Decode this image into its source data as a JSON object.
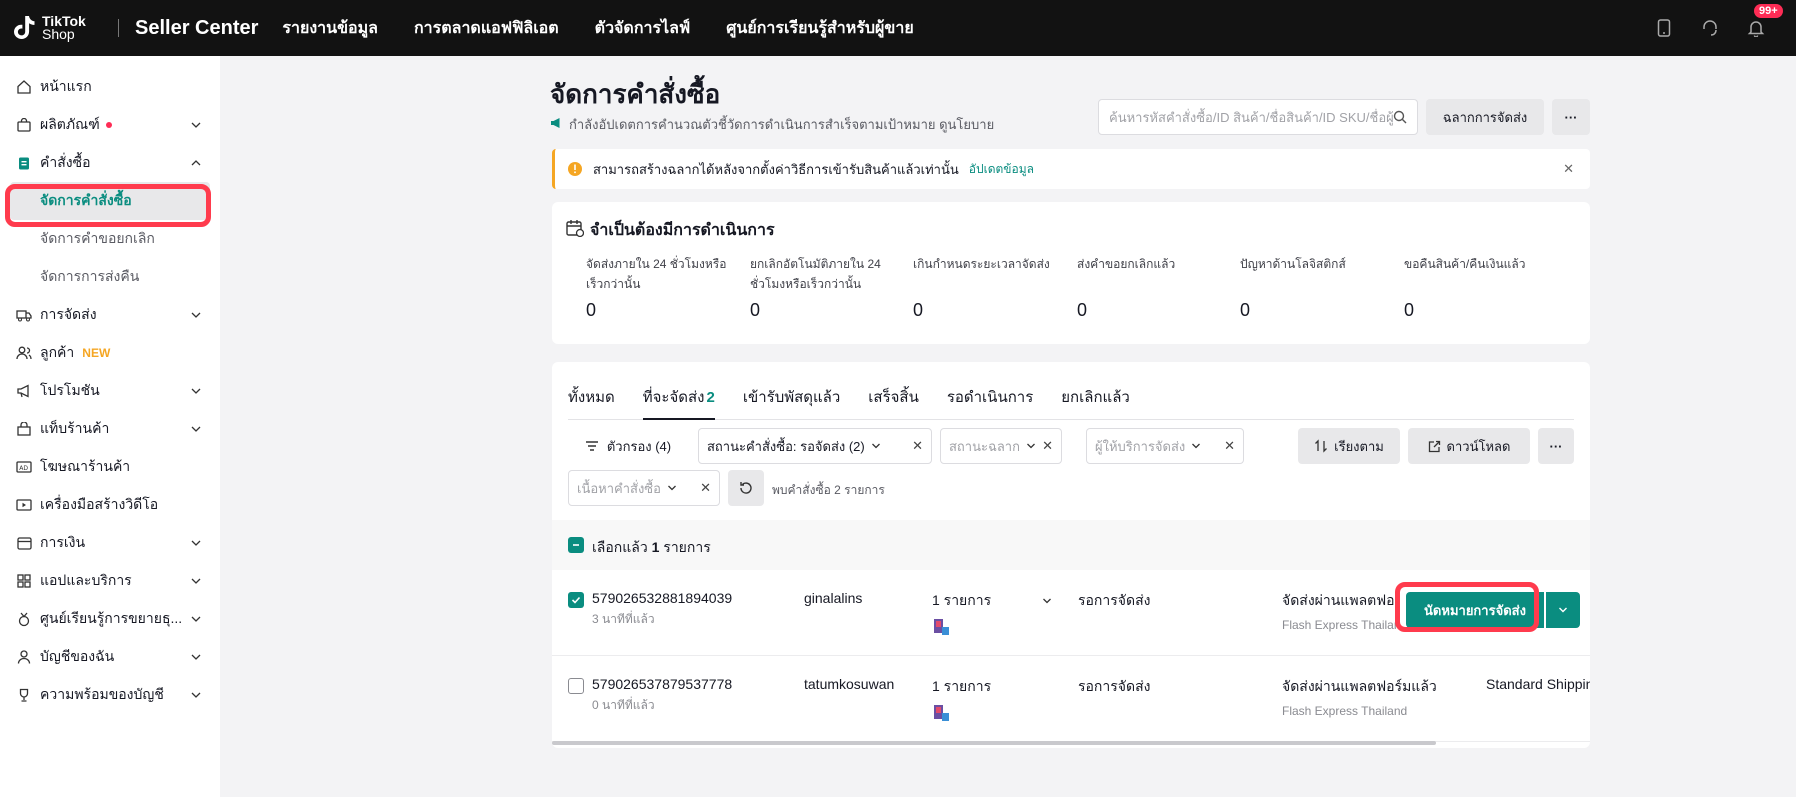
{
  "topbar": {
    "logo_text_1": "TikTok",
    "logo_text_2": "Shop",
    "app_title": "Seller Center",
    "nav": [
      "รายงานข้อมูล",
      "การตลาดแอฟฟิลิเอต",
      "ตัวจัดการไลฟ์",
      "ศูนย์การเรียนรู้สำหรับผู้ขาย"
    ],
    "notification_badge": "99+"
  },
  "sidebar": {
    "items": [
      {
        "label": "หน้าแรก",
        "icon": "home-icon"
      },
      {
        "label": "ผลิตภัณฑ์",
        "icon": "bag-icon"
      },
      {
        "label": "คำสั่งซื้อ",
        "icon": "clipboard-icon"
      },
      {
        "label": "จัดการคำสั่งซื้อ"
      },
      {
        "label": "จัดการคำขอยกเลิก"
      },
      {
        "label": "จัดการการส่งคืน"
      },
      {
        "label": "การจัดส่ง",
        "icon": "truck-icon"
      },
      {
        "label": "ลูกค้า",
        "icon": "users-icon",
        "tag": "NEW"
      },
      {
        "label": "โปรโมชัน",
        "icon": "megaphone-icon"
      },
      {
        "label": "แท็บร้านค้า",
        "icon": "store-icon"
      },
      {
        "label": "โฆษณาร้านค้า",
        "icon": "ad-icon"
      },
      {
        "label": "เครื่องมือสร้างวิดีโอ",
        "icon": "video-icon"
      },
      {
        "label": "การเงิน",
        "icon": "wallet-icon"
      },
      {
        "label": "แอปและบริการ",
        "icon": "apps-icon"
      },
      {
        "label": "ศูนย์เรียนรู้การขยายธุ...",
        "icon": "medal-icon"
      },
      {
        "label": "บัญชีของฉัน",
        "icon": "user-icon"
      },
      {
        "label": "ความพร้อมของบัญชี",
        "icon": "trophy-icon"
      }
    ]
  },
  "header": {
    "title": "จัดการคำสั่งซื้อ",
    "subtitle": "กำลังอัปเดตการคำนวณตัวชี้วัดการดำเนินการสำเร็จตามเป้าหมาย ดูนโยบาย",
    "search_placeholder": "ค้นหารหัสคำสั่งซื้อ/ID สินค้า/ชื่อสินค้า/ID SKU/ชื่อผู้",
    "label_button": "ฉลากการจัดส่ง",
    "more": "···"
  },
  "notice": {
    "text": "สามารถสร้างฉลากได้หลังจากตั้งค่าวิธีการเข้ารับสินค้าแล้วเท่านั้น",
    "link": "อัปเดตข้อมูล"
  },
  "action_required": {
    "title": "จำเป็นต้องมีการดำเนินการ",
    "stats": [
      {
        "label": "จัดส่งภายใน 24 ชั่วโมงหรือเร็วกว่านั้น",
        "value": "0"
      },
      {
        "label": "ยกเลิกอัตโนมัติภายใน 24 ชั่วโมงหรือเร็วกว่านั้น",
        "value": "0"
      },
      {
        "label": "เกินกำหนดระยะเวลาจัดส่ง",
        "value": "0"
      },
      {
        "label": "ส่งคำขอยกเลิกแล้ว",
        "value": "0"
      },
      {
        "label": "ปัญหาด้านโลจิสติกส์",
        "value": "0"
      },
      {
        "label": "ขอคืนสินค้า/คืนเงินแล้ว",
        "value": "0"
      }
    ]
  },
  "tabs": [
    {
      "label": "ทั้งหมด"
    },
    {
      "label": "ที่จะจัดส่ง",
      "count": "2"
    },
    {
      "label": "เข้ารับพัสดุแล้ว"
    },
    {
      "label": "เสร็จสิ้น"
    },
    {
      "label": "รอดำเนินการ"
    },
    {
      "label": "ยกเลิกแล้ว"
    }
  ],
  "filters": {
    "filter_button": "ตัวกรอง (4)",
    "order_status": "สถานะคำสั่งซื้อ: รอจัดส่ง (2)",
    "label_status_placeholder": "สถานะฉลาก",
    "carrier_placeholder": "ผู้ให้บริการจัดส่ง",
    "content_placeholder": "เนื้อหาคำสั่งซื้อ",
    "sort": "เรียงตาม",
    "download": "ดาวน์โหลด",
    "found_text": "พบคำสั่งซื้อ 2 รายการ"
  },
  "selection": {
    "prefix": "เลือกแล้ว",
    "count": "1",
    "suffix": "รายการ"
  },
  "orders": [
    {
      "id": "579026532881894039",
      "time": "3 นาทีที่แล้ว",
      "buyer": "ginalalins",
      "items": "1 รายการ",
      "status": "รอการจัดส่ง",
      "shipping": "จัดส่งผ่านแพลตฟอร์มแล้ว",
      "carrier": "Flash Express Thailand",
      "checked": true,
      "action": "นัดหมายการจัดส่ง"
    },
    {
      "id": "579026537879537778",
      "time": "0 นาทีที่แล้ว",
      "buyer": "tatumkosuwan",
      "items": "1 รายการ",
      "status": "รอการจัดส่ง",
      "shipping": "จัดส่งผ่านแพลตฟอร์มแล้ว",
      "carrier": "Flash Express Thailand",
      "shipping_type": "Standard Shipping",
      "checked": false
    }
  ],
  "colors": {
    "accent": "#0a8d80",
    "topbar": "#121212",
    "highlight": "#ff3b4d"
  }
}
